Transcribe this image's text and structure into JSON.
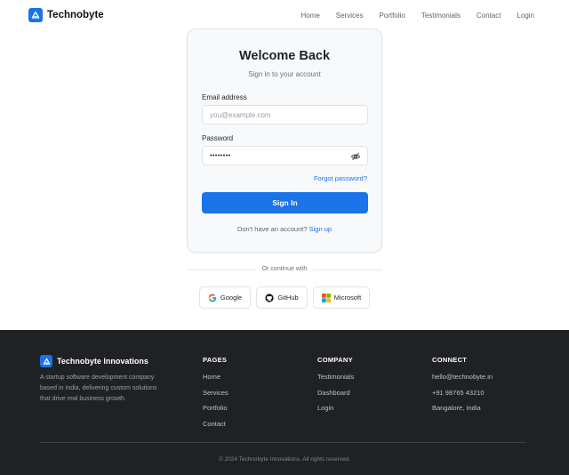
{
  "header": {
    "brand": "Technobyte",
    "nav": [
      "Home",
      "Services",
      "Portfolio",
      "Testimonials",
      "Contact",
      "Login"
    ]
  },
  "login": {
    "title": "Welcome Back",
    "subtitle": "Sign in to your account",
    "email_label": "Email address",
    "email_placeholder": "you@example.com",
    "password_label": "Password",
    "password_value": "••••••••",
    "forgot": "Forgot password?",
    "signin": "Sign In",
    "no_account": "Don't have an account?",
    "signup": "Sign up"
  },
  "divider_text": "Or continue with",
  "social": [
    "Google",
    "GitHub",
    "Microsoft"
  ],
  "footer": {
    "brand": "Technobyte Innovations",
    "description": "A startup software development company based in India, delivering custom solutions that drive real business growth.",
    "columns": [
      {
        "heading": "PAGES",
        "links": [
          "Home",
          "Services",
          "Portfolio",
          "Contact"
        ]
      },
      {
        "heading": "COMPANY",
        "links": [
          "Testimonials",
          "Dashboard",
          "Login"
        ]
      },
      {
        "heading": "CONNECT",
        "links": [
          "hello@technobyte.in",
          "+91 98765 43210",
          "Bangalore, India"
        ]
      }
    ],
    "copyright": "© 2024 Technobyte Innovations. All rights reserved."
  },
  "colors": {
    "accent": "#1a73e8",
    "footer_bg": "#202124"
  }
}
